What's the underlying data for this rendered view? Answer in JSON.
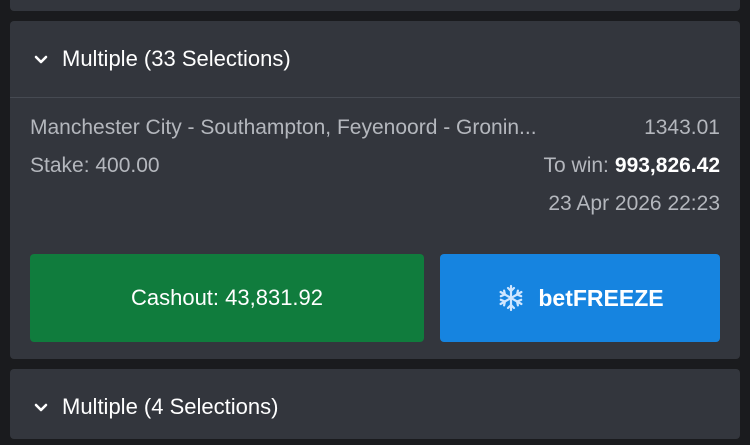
{
  "bet": {
    "header_title": "Multiple (33 Selections)",
    "selections_text": "Manchester City - Southampton, Feyenoord - Gronin...",
    "odds": "1343.01",
    "stake_text": "Stake: 400.00",
    "to_win_label": "To win:",
    "to_win_value": "993,826.42",
    "datetime": "23 Apr 2026 22:23",
    "cashout_label": "Cashout: 43,831.92",
    "freeze_label": "betFREEZE"
  },
  "next_bet": {
    "header_title": "Multiple (4 Selections)"
  },
  "colors": {
    "background": "#1a1b1e",
    "card": "#33363d",
    "cashout": "#107c3d",
    "freeze": "#1684e0"
  },
  "icons": [
    "chevron-down-icon",
    "snowflake-icon"
  ]
}
